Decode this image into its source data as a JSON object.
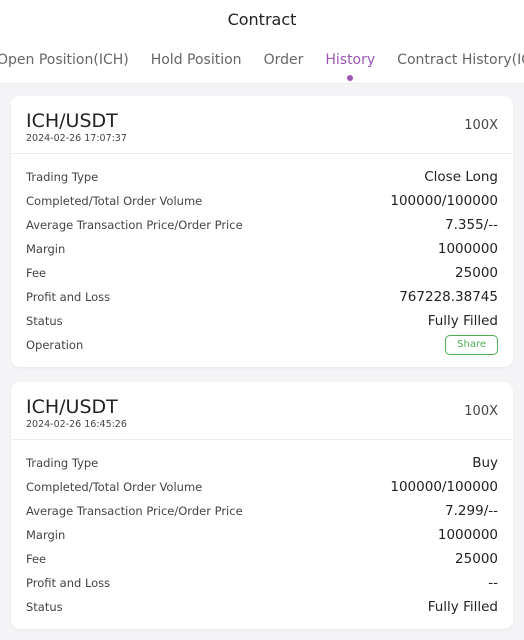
{
  "header": {
    "title": "Contract"
  },
  "tabs": [
    {
      "label": "Open Position(ICH)",
      "active": false
    },
    {
      "label": "Hold Position",
      "active": false
    },
    {
      "label": "Order",
      "active": false
    },
    {
      "label": "History",
      "active": true
    },
    {
      "label": "Contract History(ICH)",
      "active": false
    }
  ],
  "labels": {
    "trading_type": "Trading Type",
    "volume": "Completed/Total Order Volume",
    "price": "Average Transaction Price/Order Price",
    "margin": "Margin",
    "fee": "Fee",
    "pnl": "Profit and Loss",
    "status": "Status",
    "operation": "Operation",
    "share": "Share"
  },
  "orders": [
    {
      "pair": "ICH/USDT",
      "time": "2024-02-26 17:07:37",
      "leverage": "100X",
      "trading_type": "Close Long",
      "volume": "100000/100000",
      "price": "7.355/--",
      "margin": "1000000",
      "fee": "25000",
      "pnl": "767228.38745",
      "status": "Fully Filled"
    },
    {
      "pair": "ICH/USDT",
      "time": "2024-02-26 16:45:26",
      "leverage": "100X",
      "trading_type": "Buy",
      "volume": "100000/100000",
      "price": "7.299/--",
      "margin": "1000000",
      "fee": "25000",
      "pnl": "--",
      "status": "Fully Filled"
    }
  ],
  "colors": {
    "accent": "#9b57b4",
    "share_green": "#4caf50",
    "background": "#f4f4f6"
  }
}
